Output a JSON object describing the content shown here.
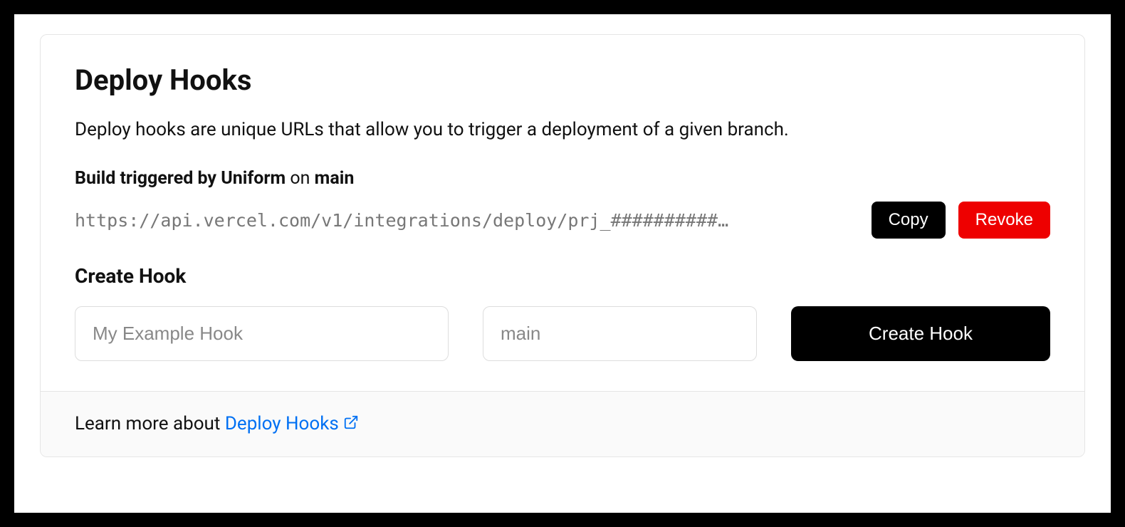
{
  "header": {
    "title": "Deploy Hooks",
    "description": "Deploy hooks are unique URLs that allow you to trigger a deployment of a given branch."
  },
  "hook": {
    "label_prefix": "Build triggered by Uniform",
    "label_sep": " on ",
    "branch": "main",
    "url": "https://api.vercel.com/v1/integrations/deploy/prj_##########…",
    "copy_label": "Copy",
    "revoke_label": "Revoke"
  },
  "create": {
    "title": "Create Hook",
    "name_placeholder": "My Example Hook",
    "branch_placeholder": "main",
    "button_label": "Create Hook"
  },
  "footer": {
    "prefix": "Learn more about ",
    "link_text": "Deploy Hooks"
  }
}
